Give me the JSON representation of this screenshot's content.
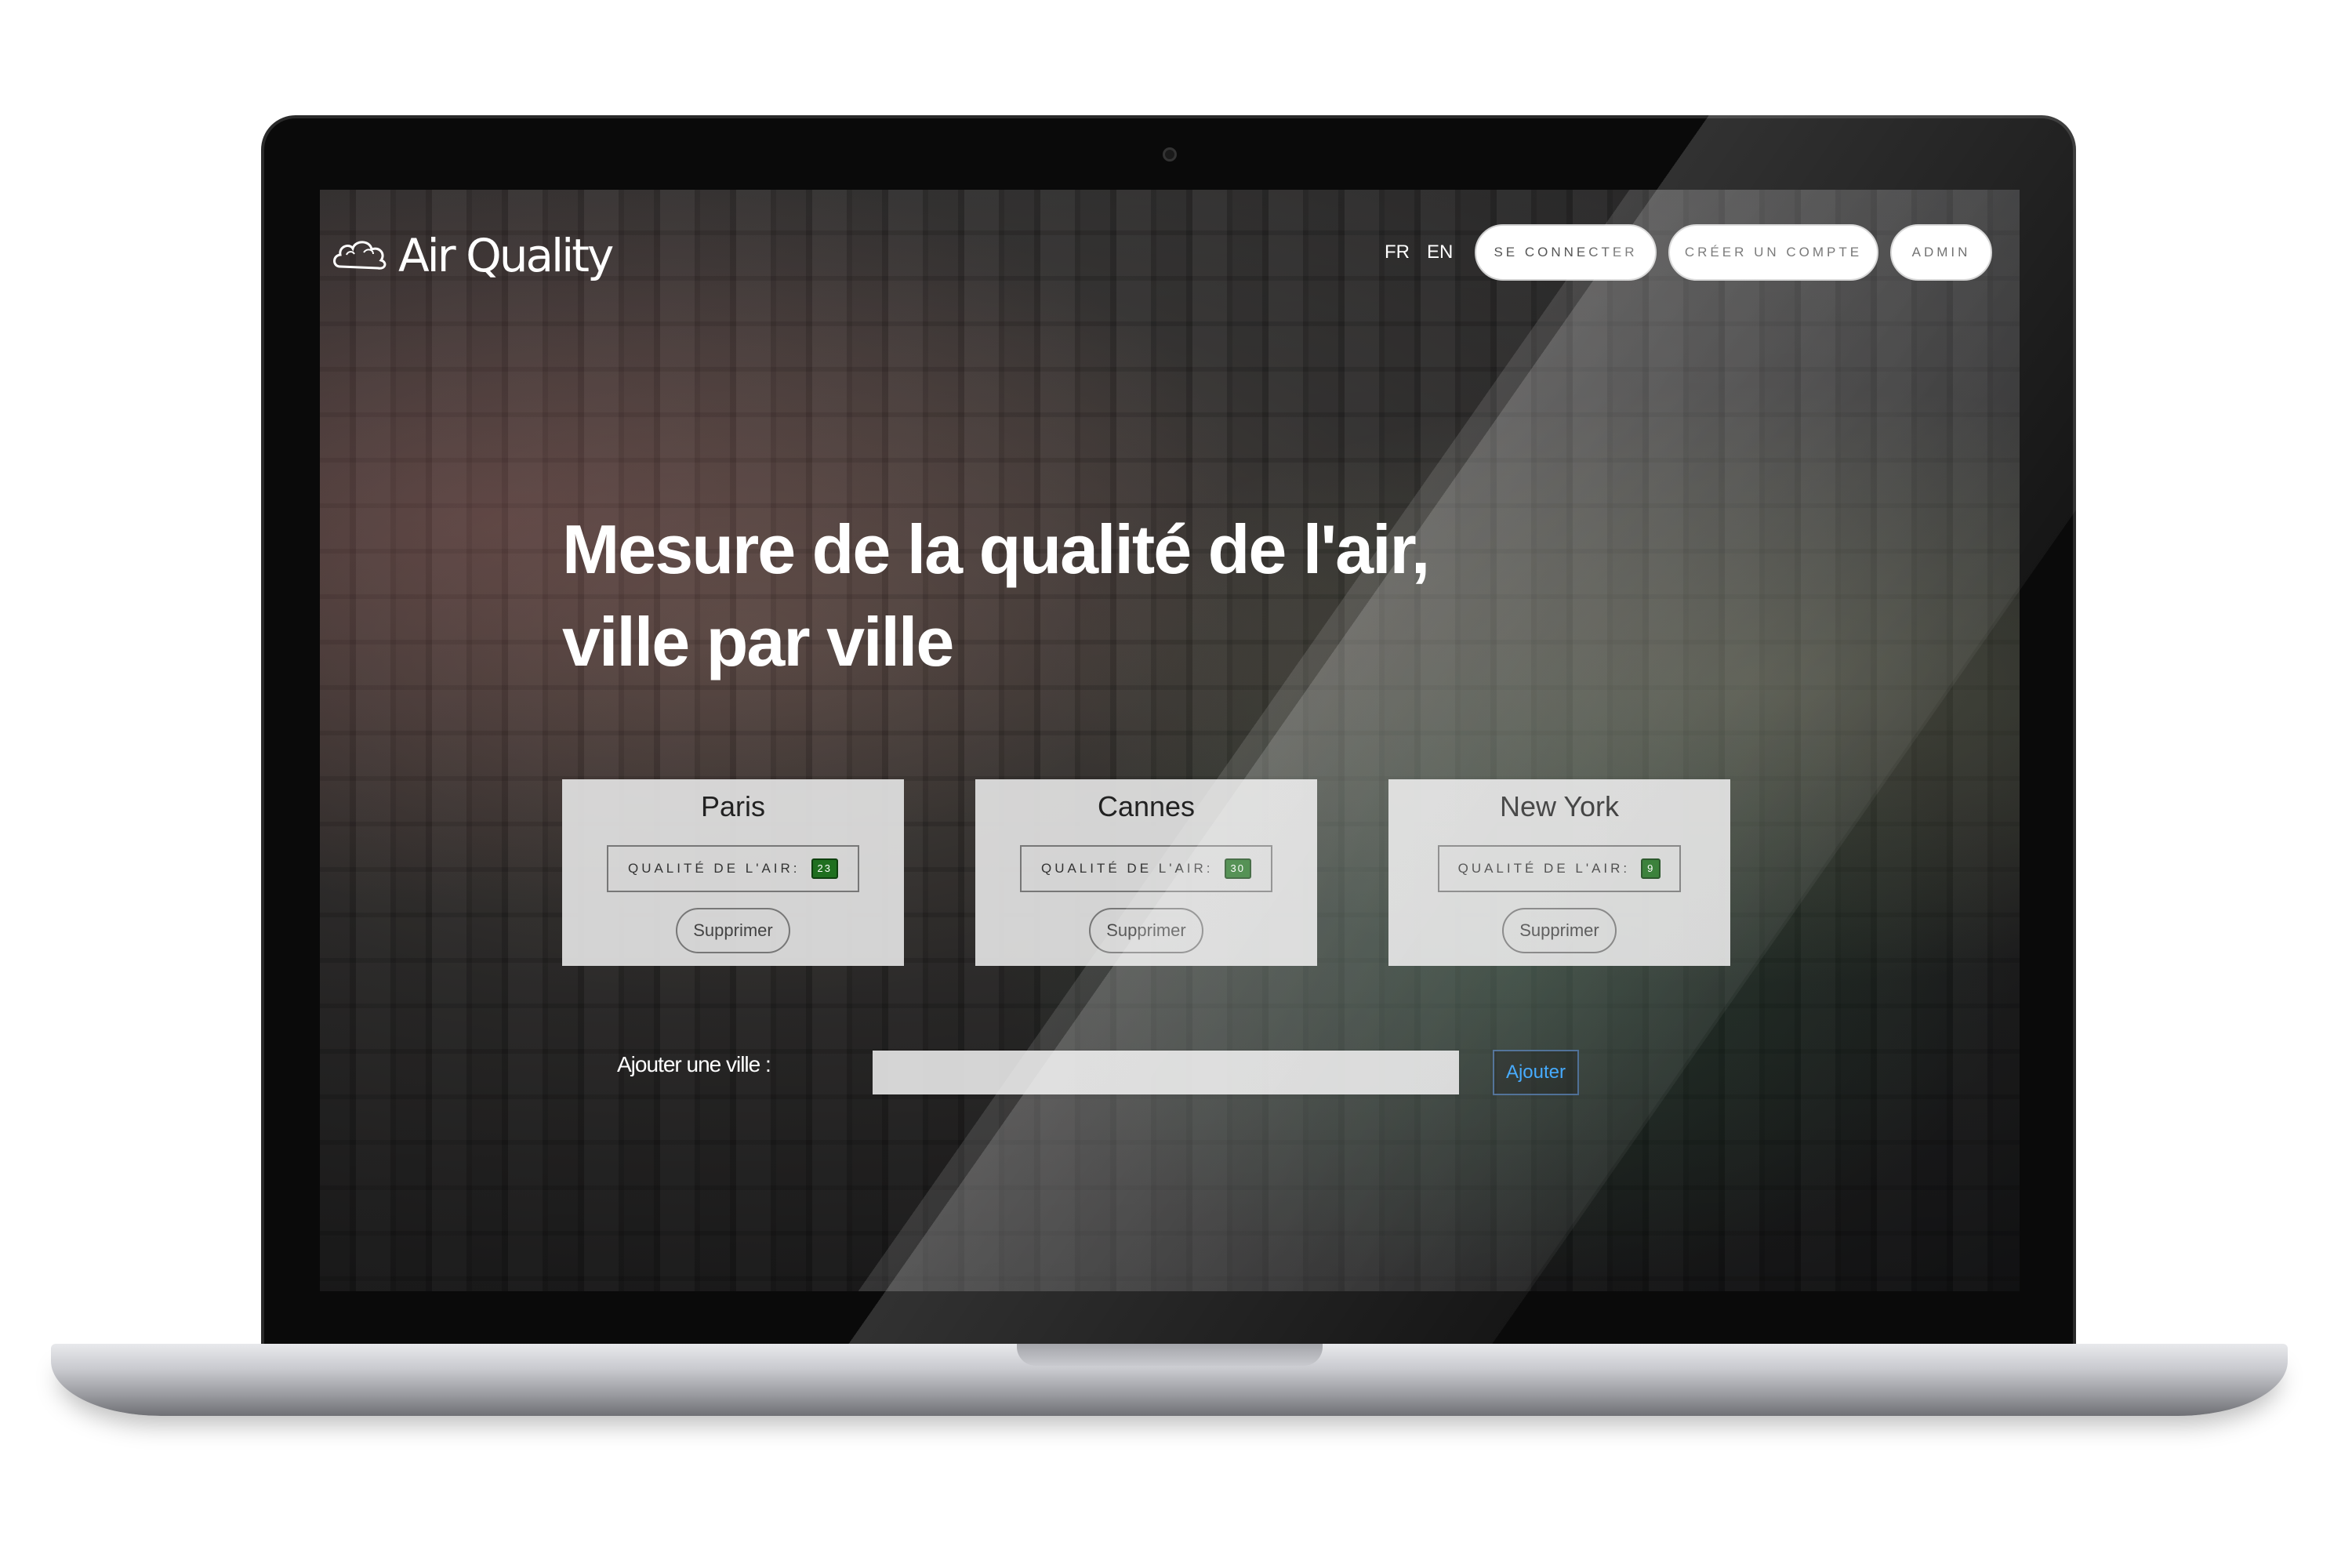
{
  "app": {
    "logo_text": "Air Quality",
    "logo_icon": "cloud-icon"
  },
  "nav": {
    "lang_fr": "FR",
    "lang_en": "EN",
    "login_label": "SE CONNECTER",
    "signup_label": "CRÉER UN COMPTE",
    "admin_label": "ADMIN"
  },
  "hero": {
    "line1": "Mesure de la qualité de l'air,",
    "line2": "ville par ville"
  },
  "cities": [
    {
      "name": "Paris",
      "aq_label": "QUALITÉ DE L'AIR:",
      "aq_value": "23",
      "delete_label": "Supprimer"
    },
    {
      "name": "Cannes",
      "aq_label": "QUALITÉ DE L'AIR:",
      "aq_value": "30",
      "delete_label": "Supprimer"
    },
    {
      "name": "New York",
      "aq_label": "QUALITÉ DE L'AIR:",
      "aq_value": "9",
      "delete_label": "Supprimer"
    }
  ],
  "add_city": {
    "label": "Ajouter une ville :",
    "input_value": "",
    "button_label": "Ajouter"
  },
  "colors": {
    "aq_badge": "#1f6f1f",
    "add_button_text": "#2da0ff"
  }
}
